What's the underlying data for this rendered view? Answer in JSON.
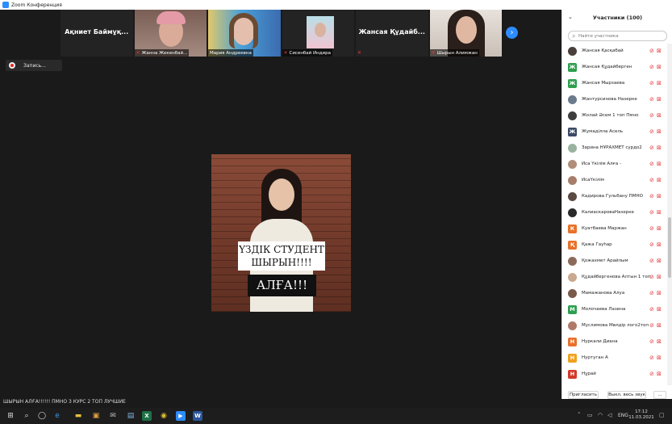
{
  "window": {
    "title": "Zoom Конференция"
  },
  "strip": {
    "tiles": [
      {
        "name": "Ақниет Баймұқ...",
        "type": "name"
      },
      {
        "name": "Жанна Жекенбай...",
        "type": "video",
        "muted": true
      },
      {
        "name": "Мария Андреевна",
        "type": "video",
        "muted": false
      },
      {
        "name": "Сисенбай Индира",
        "type": "video",
        "muted": true
      },
      {
        "name": "Жансая Құдайб...",
        "type": "name"
      },
      {
        "name": "Шырын Алимжан",
        "type": "video",
        "muted": true
      }
    ],
    "next_icon": "chevron-right-icon"
  },
  "recording": {
    "label": "Запись..."
  },
  "main_video": {
    "sticker_line1": "ҮЗДІК СТУДЕНТ",
    "sticker_line2": "ШЫРЫН!!!!",
    "sticker_bottom": "АЛҒА!!!"
  },
  "bottom_caption": "ШЫРЫН АЛҒА!!!!!! ПМНО 3 КУРС 2 ТОП ЛУЧШИЕ",
  "panel": {
    "title": "Участники (100)",
    "search_placeholder": "Найти участника",
    "participants": [
      {
        "name": "Жансая Қасқабай",
        "avatar": "photo",
        "color": "#4a3f3a"
      },
      {
        "name": "Жансая Құдайберген",
        "avatar": "letter",
        "letter": "Ж",
        "color": "#2e9e4f"
      },
      {
        "name": "Жансая Мырзаева",
        "avatar": "letter",
        "letter": "Ж",
        "color": "#2e9e4f"
      },
      {
        "name": "Жантурсинова Назерке",
        "avatar": "photo",
        "color": "#6b7a8c"
      },
      {
        "name": "Жолай Әсем 1 топ Пмно",
        "avatar": "photo",
        "color": "#3d3d3d"
      },
      {
        "name": "Жумаділла Асель",
        "avatar": "letter",
        "letter": "Ж",
        "color": "#3a4a66"
      },
      {
        "name": "Зарина НҰРАХМЕТ сурдо2",
        "avatar": "photo",
        "color": "#9ab3a0"
      },
      {
        "name": "Иса Үкілім Алға -",
        "avatar": "photo",
        "color": "#b08e78"
      },
      {
        "name": "ИсаҮкілім",
        "avatar": "photo",
        "color": "#a67e6a"
      },
      {
        "name": "Кадирова Гульбану ПМНО",
        "avatar": "photo",
        "color": "#5a4a42"
      },
      {
        "name": "КалиаскароваНазерке",
        "avatar": "photo",
        "color": "#2a2a2a"
      },
      {
        "name": "Куатбаева Маржан",
        "avatar": "letter",
        "letter": "К",
        "color": "#e8712a"
      },
      {
        "name": "Қажа Гауһар",
        "avatar": "letter",
        "letter": "Қ",
        "color": "#e8712a"
      },
      {
        "name": "Қожахмет Арайлым",
        "avatar": "photo",
        "color": "#8c6a5a"
      },
      {
        "name": "Құдайбергенова Алтын 1 топ",
        "avatar": "photo",
        "color": "#c9a98f"
      },
      {
        "name": "Мамажанова Алуа",
        "avatar": "photo",
        "color": "#7a5a4a"
      },
      {
        "name": "Молочаева Лазина",
        "avatar": "letter",
        "letter": "М",
        "color": "#2e9e4f"
      },
      {
        "name": "Муслимова Мөлдір логo2топ",
        "avatar": "photo",
        "color": "#b07a6a"
      },
      {
        "name": "Нуркали Диана",
        "avatar": "letter",
        "letter": "Н",
        "color": "#e8712a"
      },
      {
        "name": "Нуртуган А",
        "avatar": "letter",
        "letter": "Н",
        "color": "#f0a020"
      },
      {
        "name": "Нұрай",
        "avatar": "letter",
        "letter": "Н",
        "color": "#d23a2a"
      },
      {
        "name": "",
        "avatar": "letter",
        "letter": "",
        "color": "#d23a2a"
      }
    ],
    "invite_label": "Пригласить",
    "mute_all_label": "Выкл. весь звук",
    "more_label": "..."
  },
  "taskbar": {
    "lang": "ENG",
    "time": "17:12",
    "date": "11.03.2021"
  }
}
